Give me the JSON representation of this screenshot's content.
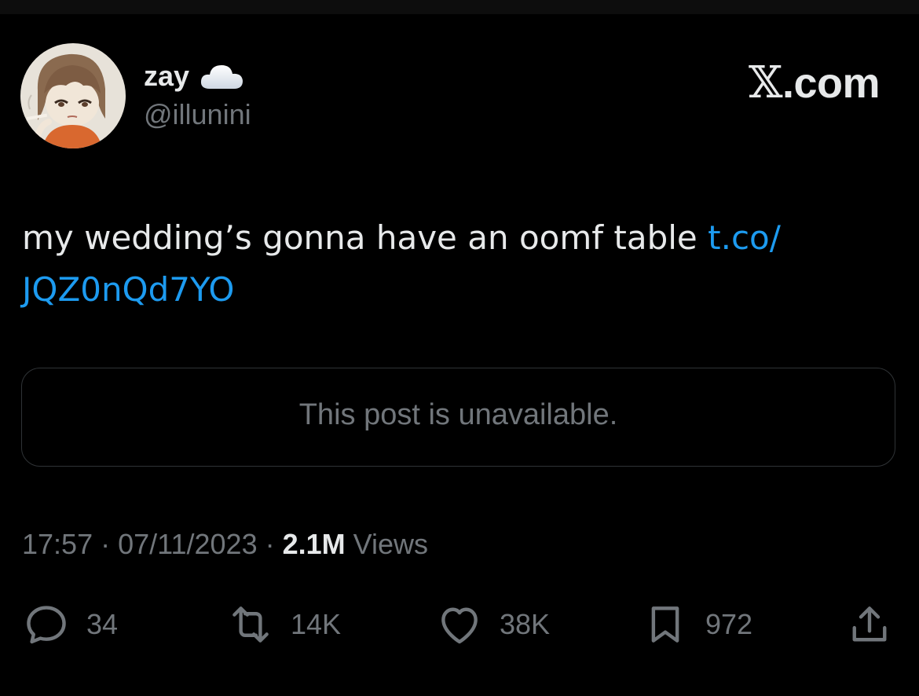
{
  "author": {
    "display_name": "zay",
    "handle": "@illunini",
    "badge_icon": "cloud-icon",
    "avatar": "illustrated-girl-avatar"
  },
  "brand": {
    "x_glyph": "𝕏",
    "suffix": ".com"
  },
  "tweet": {
    "text": "my wedding’s gonna have an oomf table ",
    "link_part1": "t.co/",
    "link_part2": "JQZ0nQd7YO"
  },
  "quote": {
    "text": "This post is unavailable."
  },
  "meta": {
    "time": "17:57",
    "separator": " · ",
    "date": "07/11/2023",
    "views_count": "2.1M",
    "views_label": " Views"
  },
  "actions": {
    "replies": "34",
    "reposts": "14K",
    "likes": "38K",
    "bookmarks": "972"
  },
  "colors": {
    "background": "#000000",
    "text": "#e7e9ea",
    "secondary": "#71767b",
    "link": "#1d9bf0",
    "border": "#2f3336"
  }
}
